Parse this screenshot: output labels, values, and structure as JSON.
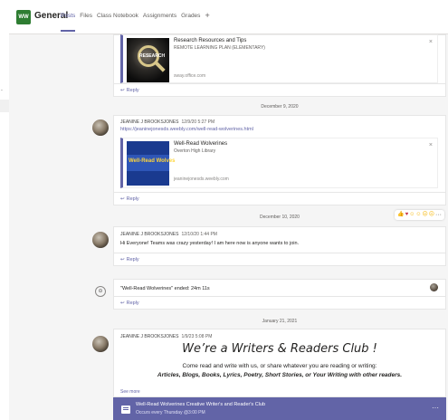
{
  "team": {
    "initials": "WW",
    "color": "#2e7d32"
  },
  "channel": {
    "name": "General"
  },
  "tabs": [
    {
      "label": "Posts",
      "active": true
    },
    {
      "label": "Files"
    },
    {
      "label": "Class Notebook"
    },
    {
      "label": "Assignments"
    },
    {
      "label": "Grades"
    }
  ],
  "add_tab": "+",
  "accent_color": "#6264a7",
  "left_rail": {
    "dot": "."
  },
  "posts": [
    {
      "preview": {
        "title": "Research Resources and Tips",
        "subtitle": "REMOTE LEARNING PLAN (ELEMENTARY)",
        "url": "sway.office.com",
        "thumb_label": "RESEARCH",
        "close": "×"
      },
      "reply": "Reply"
    },
    {
      "date_divider": "December 9, 2020",
      "author": "JEANINE J BROOKSJONES",
      "time": "12/9/20 5:27 PM",
      "link": "https://jeaninejonesds.weebly.com/well-read-wolverines.html",
      "preview": {
        "title": "Well-Read Wolverines",
        "subtitle": "Overton High Library",
        "url": "jeaninejonesds.weebly.com",
        "thumb_label": "Well-Read Wolves",
        "close": "×"
      },
      "reply": "Reply"
    },
    {
      "date_divider": "December 10, 2020",
      "author": "JEANINE J BROOKSJONES",
      "time": "12/10/20 1:44 PM",
      "text": "Hi Everyone! Teams was crazy yesterday! I am here now is anyone wants to join.",
      "reactions": [
        "like-icon",
        "heart-icon",
        "laugh-icon",
        "surprised-icon",
        "sad-icon",
        "angry-icon"
      ],
      "more": "···",
      "reply": "Reply"
    },
    {
      "meeting_text": "\"Well-Read Wolverines\" ended: 24m 11s",
      "reply": "Reply"
    },
    {
      "date_divider": "January 21, 2021",
      "author": "JEANINE J BROOKSJONES",
      "time": "1/9/23 5:08 PM",
      "title": "We’re a Writers & Readers Club !",
      "line1": "Come read and write with us, or share whatever you are reading or writing:",
      "line2": "Articles, Blogs, Books, Lyrics, Poetry, Short Stories, or Your Writing with other readers.",
      "see_more": "See more",
      "meeting_bar": {
        "title": "Well-Read Wolverines Creative Writer's and Reader's Club",
        "subtitle": "Occurs every Thursday @3:00 PM",
        "more": "···"
      }
    }
  ]
}
